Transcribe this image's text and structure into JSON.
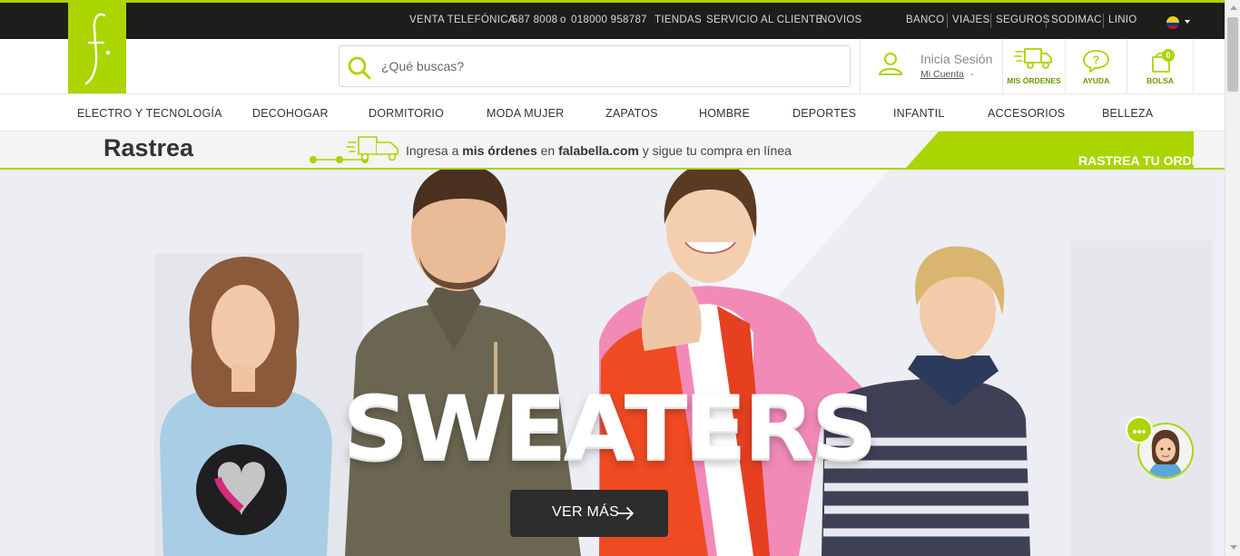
{
  "brand": {
    "logo_text": "f.",
    "accent_color": "#aad500",
    "topbar_color": "#1d1d1b"
  },
  "topbar": {
    "phone_label": "VENTA TELEFÓNICA",
    "phone_local": "587 8008",
    "phone_or": "o",
    "phone_national": "018000 958787",
    "links": [
      "TIENDAS",
      "SERVICIO AL CLIENTE",
      "NOVIOS"
    ],
    "partners": [
      "BANCO",
      "VIAJES",
      "SEGUROS",
      "SODIMAC",
      "LINIO"
    ],
    "country_flag_icon": "colombia-flag-icon"
  },
  "header": {
    "search_placeholder": "¿Qué buscas?",
    "login_label": "Inicia Sesión",
    "account_label": "Mi Cuenta",
    "orders_label": "MIS ÓRDENES",
    "help_label": "AYUDA",
    "bag_label": "BOLSA",
    "bag_count": "0"
  },
  "nav": {
    "items": [
      "ELECTRO Y TECNOLOGÍA",
      "DECOHOGAR",
      "DORMITORIO",
      "MODA MUJER",
      "ZAPATOS",
      "HOMBRE",
      "DEPORTES",
      "INFANTIL",
      "ACCESORIOS",
      "BELLEZA"
    ]
  },
  "tracking": {
    "title": "Rastrea",
    "text_1": "Ingresa a ",
    "text_bold_1": "mis órdenes",
    "text_2": " en ",
    "text_bold_2": "falabella.com",
    "text_3": " y sigue tu compra en línea",
    "button_label": "RASTREA TU ORDEN",
    "button_arrow": "→"
  },
  "hero": {
    "title": "SWEATERS",
    "cta_label": "VER MÁS"
  }
}
